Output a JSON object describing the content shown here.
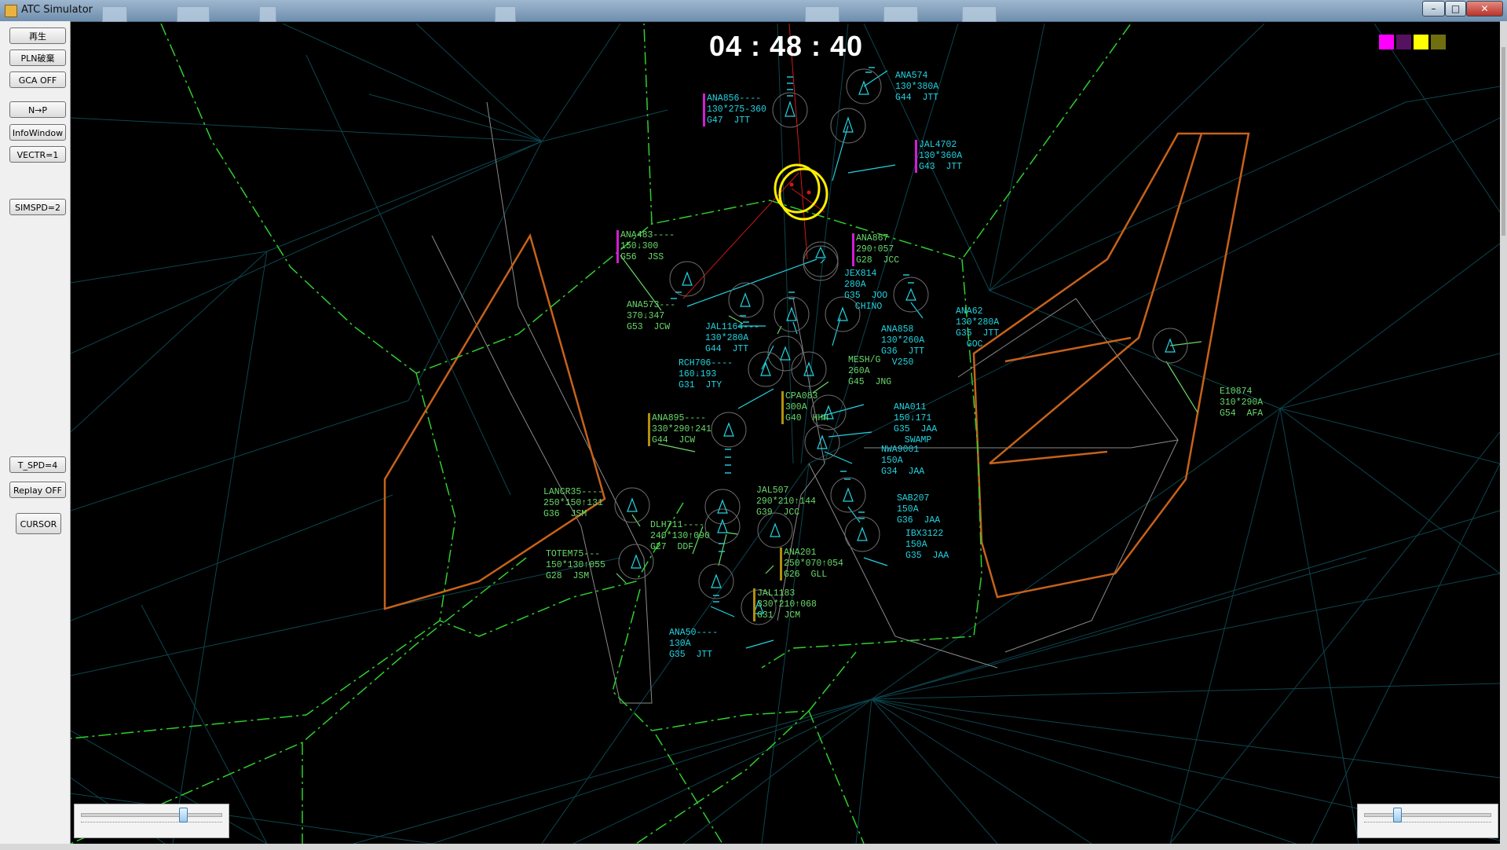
{
  "window": {
    "title": "ATC Simulator"
  },
  "window_controls": {
    "minimize": "–",
    "maximize": "□",
    "close": "✕"
  },
  "buttons": {
    "play": "再生",
    "pln_discard": "PLN破棄",
    "gca": "GCA OFF",
    "n_p": "N→P",
    "info_window": "InfoWindow",
    "vectr": "VECTR=1",
    "simspd": "SIMSPD=2",
    "t_spd": "T_SPD=4",
    "replay": "Replay OFF",
    "cursor": "CURSOR"
  },
  "clock": "04 : 48 : 40",
  "swatches": [
    "#ff00ff",
    "#55125e",
    "#ffff00",
    "#6f6f10"
  ],
  "sliders": {
    "left_value_fraction": 0.73,
    "right_value_fraction": 0.24
  },
  "colors": {
    "cyan_label": "#22d3e0",
    "green_label": "#69d86a",
    "boundary_green": "#2fcf2f",
    "restricted_orange": "#c7621a",
    "airway_grey": "#0c4650",
    "conflict_yellow": "#ffef00",
    "route_red": "#d21818",
    "magenta_tag": "#d41cd4",
    "olive_tag": "#b0900c"
  },
  "flights": [
    {
      "id": "ana574",
      "lines": [
        "ANA574",
        "130*380A",
        "G44  JTT"
      ],
      "color": "cyan"
    },
    {
      "id": "ana856",
      "lines": [
        "ANA856----",
        "130*275-360",
        "G47  JTT"
      ],
      "color": "cyan",
      "tag": "magenta"
    },
    {
      "id": "jal4702",
      "lines": [
        "JAL4702",
        "130*360A",
        "G43  JTT"
      ],
      "color": "cyan",
      "tag": "magenta"
    },
    {
      "id": "ana483",
      "lines": [
        "ANA483----",
        "150↓300",
        "G56  JSS"
      ],
      "color": "green",
      "tag": "magenta"
    },
    {
      "id": "ana867",
      "lines": [
        "ANA867",
        "290↑057",
        "G28  JCC"
      ],
      "color": "green",
      "tag": "magenta"
    },
    {
      "id": "jex814",
      "lines": [
        "JEX814",
        "280A",
        "G35  JOO",
        "  CHINO"
      ],
      "color": "cyan"
    },
    {
      "id": "ana573",
      "lines": [
        "ANA573---",
        "370↓347",
        "G53  JCW"
      ],
      "color": "green"
    },
    {
      "id": "ana62",
      "lines": [
        "ANA62",
        "130*280A",
        "G35  JTT",
        "  GOC"
      ],
      "color": "cyan"
    },
    {
      "id": "jal1164",
      "lines": [
        "JAL1164---",
        "130*280A",
        "G44  JTT"
      ],
      "color": "cyan"
    },
    {
      "id": "ana858",
      "lines": [
        "ANA858",
        "130*260A",
        "G36  JTT",
        "  V250"
      ],
      "color": "cyan"
    },
    {
      "id": "rch706",
      "lines": [
        "RCH706----",
        "160↓193",
        "G31  JTY"
      ],
      "color": "cyan"
    },
    {
      "id": "mesh",
      "lines": [
        "MESH/G",
        "260A",
        "G45  JNG"
      ],
      "color": "green"
    },
    {
      "id": "e10874",
      "lines": [
        "E10874",
        "310*290A",
        "G54  AFA"
      ],
      "color": "green"
    },
    {
      "id": "cpa083",
      "lines": [
        "CPA083",
        "300A",
        "G40  HHH"
      ],
      "color": "green",
      "tag": "olive"
    },
    {
      "id": "ana011",
      "lines": [
        "ANA011",
        "150↓171",
        "G35  JAA",
        "  SWAMP"
      ],
      "color": "cyan"
    },
    {
      "id": "ana895",
      "lines": [
        "ANA895----",
        "330*290↑241",
        "G44  JCW"
      ],
      "color": "green",
      "tag": "olive"
    },
    {
      "id": "nwa9001",
      "lines": [
        "NWA9001",
        "150A",
        "G34  JAA"
      ],
      "color": "cyan"
    },
    {
      "id": "lancr35",
      "lines": [
        "LANCR35----",
        "250*150↑131",
        "G36  JSM"
      ],
      "color": "green"
    },
    {
      "id": "jal507",
      "lines": [
        "JAL507",
        "290*210↑144",
        "G39  JCC"
      ],
      "color": "green"
    },
    {
      "id": "sab207",
      "lines": [
        "SAB207",
        "150A",
        "G36  JAA"
      ],
      "color": "cyan"
    },
    {
      "id": "dlh711",
      "lines": [
        "DLH711----",
        "240*130↑090",
        "G27  DDF"
      ],
      "color": "green"
    },
    {
      "id": "ibx3122",
      "lines": [
        "IBX3122",
        "150A",
        "G35  JAA"
      ],
      "color": "cyan"
    },
    {
      "id": "totem75",
      "lines": [
        "TOTEM75---",
        "150*130↑055",
        "G28  JSM"
      ],
      "color": "green"
    },
    {
      "id": "ana201",
      "lines": [
        "ANA201",
        "250*070↑054",
        "G26  GLL"
      ],
      "color": "green",
      "tag": "olive"
    },
    {
      "id": "jal1183",
      "lines": [
        "JAL1183",
        "330*210↑068",
        "G31  JCM"
      ],
      "color": "green",
      "tag": "olive"
    },
    {
      "id": "ana50",
      "lines": [
        "ANA50----",
        "130A",
        "G35  JTT"
      ],
      "color": "cyan"
    }
  ]
}
